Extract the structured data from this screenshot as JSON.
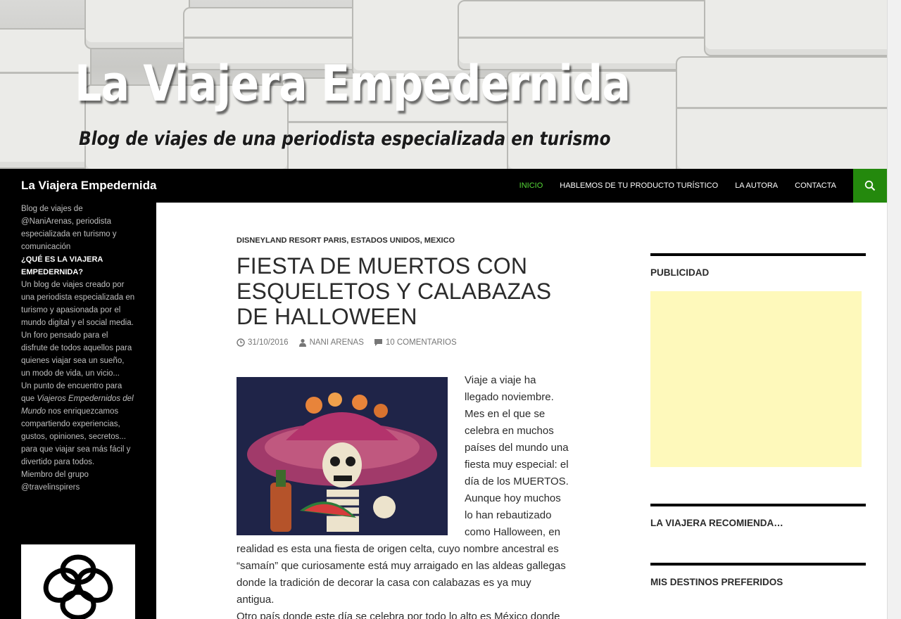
{
  "banner": {
    "title": "La Viajera Empedernida",
    "subtitle": "Blog de viajes de una periodista especializada en turismo"
  },
  "navbar": {
    "site_title": "La Viajera Empedernida",
    "items": [
      {
        "label": "INICIO",
        "active": true
      },
      {
        "label": "HABLEMOS DE TU PRODUCTO TURÍSTICO",
        "active": false
      },
      {
        "label": "LA AUTORA",
        "active": false
      },
      {
        "label": "CONTACTA",
        "active": false
      }
    ],
    "search_icon": "search-icon",
    "active_color": "#55d737",
    "search_bg": "#24890d"
  },
  "sidebar": {
    "description": "Blog de viajes de @NaniArenas, periodista especializada en turismo y comunicación",
    "heading": "¿QUÉ ES LA VIAJERA EMPEDERNIDA?",
    "about_p1": "Un blog de viajes creado por una periodista especializada en turismo y apasionada por el mundo digital y el social media. Un foro pensado para el disfrute de todos aquellos para quienes viajar sea un sueño, un modo de vida, un vicio...",
    "about_p2_before": "Un punto de encuentro para que ",
    "about_p2_italic": "Viajeros Empedernidos del Mundo",
    "about_p2_after": " nos enriquezcamos compartiendo experiencias, gustos, opiniones, secretos... para que viajar sea más fácil y divertido para todos.",
    "member": "Miembro del grupo @travelinspirers"
  },
  "post": {
    "categories": [
      "DISNEYLAND RESORT PARIS",
      "ESTADOS UNIDOS",
      "MEXICO"
    ],
    "title": "FIESTA DE MUERTOS CON ESQUELETOS Y CALABAZAS DE HALLOWEEN",
    "date": "31/10/2016",
    "author": "NANI ARENAS",
    "comments": "10 COMENTARIOS",
    "paragraph1": "Viaje a viaje ha llegado noviembre. Mes en el que se celebra en muchos países del mundo una fiesta muy especial: el día de los MUERTOS.",
    "paragraph2": "Aunque hoy muchos lo han rebautizado como Halloween, en realidad es esta una fiesta de origen celta, cuyo nombre ancestral es “samaín” que curiosamente está muy arraigado en las aldeas gallegas donde la tradición de decorar la casa con calabazas es ya muy antigua.",
    "paragraph3": "Otro país donde este día se celebra por todo lo alto es México donde"
  },
  "widgets": [
    {
      "title": "PUBLICIDAD"
    },
    {
      "title": "LA VIAJERA RECOMIENDA…"
    },
    {
      "title": "MIS DESTINOS PREFERIDOS"
    }
  ],
  "colors": {
    "ad_background": "#fef9bb"
  }
}
